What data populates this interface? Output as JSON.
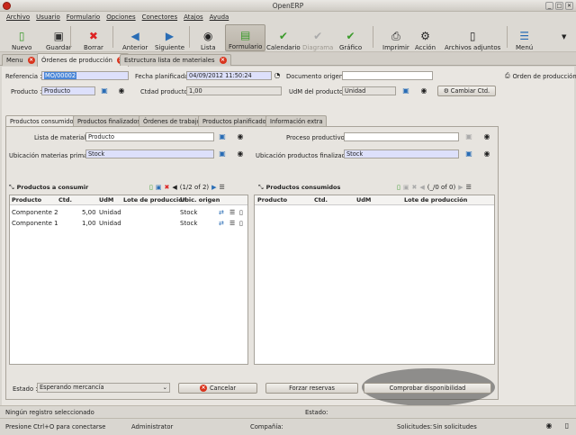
{
  "window": {
    "title": "OpenERP"
  },
  "menu": [
    "Archivo",
    "Usuario",
    "Formulario",
    "Opciones",
    "Conectores",
    "Atajos",
    "Ayuda"
  ],
  "toolbar": {
    "nuevo": "Nuevo",
    "guardar": "Guardar",
    "borrar": "Borrar",
    "anterior": "Anterior",
    "siguiente": "Siguiente",
    "lista": "Lista",
    "formulario": "Formulario",
    "calendario": "Calendario",
    "diagrama": "Diagrama",
    "grafico": "Gráfico",
    "imprimir": "Imprimir",
    "accion": "Acción",
    "adjuntos": "Archivos adjuntos",
    "menu": "Menú"
  },
  "tabs": [
    "Menu",
    "Órdenes de producción",
    "Estructura lista de materiales"
  ],
  "form": {
    "referencia_label": "Referencia :",
    "referencia": "MO/00002",
    "fecha_label": "Fecha planificada :",
    "fecha": "04/09/2012 11:50:24",
    "origen_label": "Documento origen :",
    "origen": "",
    "producto_label": "Producto :",
    "producto": "Producto",
    "cantidad_label": "Ctdad producto :",
    "cantidad": "1,00",
    "udm_label": "UdM del producto :",
    "udm": "Unidad",
    "cambiar_label": "Cambiar Ctd.",
    "side_label": "Orden de producción"
  },
  "inner_tabs": [
    "Productos consumidos",
    "Productos finalizados",
    "Órdenes de trabajo",
    "Productos planificados",
    "Información extra"
  ],
  "consumed": {
    "lista_label": "Lista de material :",
    "lista": "Producto",
    "proceso_label": "Proceso productivo :",
    "proceso": "",
    "ubic_mp_label": "Ubicación materias primas :",
    "ubic_mp": "Stock",
    "ubic_pf_label": "Ubicación productos finalizados :",
    "ubic_pf": "Stock"
  },
  "to_consume": {
    "title": "Productos a consumir",
    "pager": "(1/2 of 2)",
    "columns": [
      "Producto",
      "Ctd.",
      "UdM",
      "Lote de producción",
      "Ubic. origen"
    ],
    "rows": [
      {
        "producto": "Componente 2",
        "ctd": "5,00",
        "udm": "Unidad",
        "lote": "",
        "ubic": "Stock"
      },
      {
        "producto": "Componente 1",
        "ctd": "1,00",
        "udm": "Unidad",
        "lote": "",
        "ubic": "Stock"
      }
    ]
  },
  "consumed_list": {
    "title": "Productos consumidos",
    "pager": "(_/0 of 0)",
    "columns": [
      "Producto",
      "Ctd.",
      "UdM",
      "Lote de producción"
    ]
  },
  "footer": {
    "estado_label": "Estado :",
    "estado": "Esperando mercancía",
    "cancelar": "Cancelar",
    "forzar": "Forzar reservas",
    "comprobar": "Comprobar disponibilidad"
  },
  "statusbar": {
    "registro": "Ningún registro seleccionado",
    "estado": "Estado:",
    "conectar": "Presione Ctrl+O para conectarse",
    "usuario": "Administrator",
    "compania": "Compañía:",
    "solicitudes": "Solicitudes:",
    "sin_solicitudes": "Sin solicitudes"
  },
  "colors": {
    "required_field": "#dde0fb",
    "close_red": "#d9331c",
    "accent_blue": "#2a6db5"
  }
}
